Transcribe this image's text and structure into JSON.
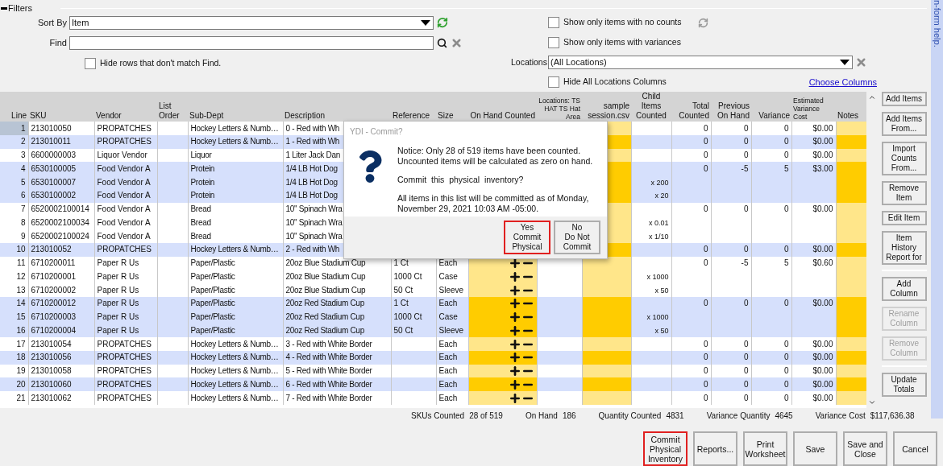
{
  "filters": {
    "title": "Filters",
    "sort_by": {
      "label": "Sort By",
      "value": "Item"
    },
    "find": {
      "label": "Find"
    },
    "hide_rows": {
      "label": "Hide rows that don't match Find.",
      "checked": false
    },
    "no_counts": {
      "label": "Show only items with no counts",
      "checked": false
    },
    "variances": {
      "label": "Show only items with variances",
      "checked": false
    },
    "locations": {
      "label": "Locations",
      "value": "(All Locations)"
    },
    "hide_locations": {
      "label": "Hide All Locations Columns",
      "checked": false
    },
    "choose_columns": "Choose Columns"
  },
  "table": {
    "columns": [
      "Line",
      "SKU",
      "Vendor",
      "List Order",
      "Sub-Dept",
      "Description",
      "Reference",
      "Size",
      "On Hand Counted",
      "Locations: TS HAT TS Hat Area",
      "sample session.csv",
      "Child Items Counted",
      "Total Counted",
      "Previous On Hand",
      "Variance",
      "Estimated Variance Cost",
      "Notes"
    ],
    "rows": [
      {
        "line": "1",
        "sku": "213010050",
        "vendor": "PROPATCHES",
        "sub_dept": "Hockey Letters & Numb…",
        "description": "0 - Red with Wh",
        "total": "0",
        "previous": "0",
        "variance": "0",
        "cost": "$0.00",
        "shaded": false,
        "selected": true
      },
      {
        "line": "2",
        "sku": "213010011",
        "vendor": "PROPATCHES",
        "sub_dept": "Hockey Letters & Numb…",
        "description": "1 - Red with Wh",
        "total": "0",
        "previous": "0",
        "variance": "0",
        "cost": "$0.00",
        "shaded": true,
        "selected": false
      },
      {
        "line": "3",
        "sku": "6600000003",
        "vendor": "Liquor Vendor",
        "sub_dept": "Liquor",
        "description": "1 Liter Jack Dan",
        "total": "0",
        "previous": "0",
        "variance": "0",
        "cost": "$0.00",
        "shaded": false,
        "selected": false
      },
      {
        "line": "4",
        "sku": "6530100005",
        "vendor": "Food Vendor A",
        "sub_dept": "Protein",
        "description": "1/4 LB Hot Dog",
        "total": "0",
        "previous": "-5",
        "variance": "5",
        "cost": "$3.00",
        "shaded": true,
        "selected": false
      },
      {
        "line": "5",
        "sku": "6530100007",
        "vendor": "Food Vendor A",
        "sub_dept": "Protein",
        "description": "1/4 LB Hot Dog",
        "child": "x 200",
        "shaded": true,
        "selected": false
      },
      {
        "line": "6",
        "sku": "6530100002",
        "vendor": "Food Vendor A",
        "sub_dept": "Protein",
        "description": "1/4 LB Hot Dog",
        "child": "x 20",
        "shaded": true,
        "selected": false
      },
      {
        "line": "7",
        "sku": "6520002100014",
        "vendor": "Food Vendor A",
        "sub_dept": "Bread",
        "description": "10\" Spinach Wra",
        "total": "0",
        "previous": "0",
        "variance": "0",
        "cost": "$0.00",
        "shaded": false,
        "selected": false
      },
      {
        "line": "8",
        "sku": "6520002100034",
        "vendor": "Food Vendor A",
        "sub_dept": "Bread",
        "description": "10\" Spinach Wra",
        "child": "x 0.01",
        "shaded": false,
        "selected": false
      },
      {
        "line": "9",
        "sku": "6520002100024",
        "vendor": "Food Vendor A",
        "sub_dept": "Bread",
        "description": "10\" Spinach Wra",
        "child": "x 1/10",
        "shaded": false,
        "selected": false
      },
      {
        "line": "10",
        "sku": "213010052",
        "vendor": "PROPATCHES",
        "sub_dept": "Hockey Letters & Numb…",
        "description": "2 - Red with Wh",
        "total": "0",
        "previous": "0",
        "variance": "0",
        "cost": "$0.00",
        "shaded": true,
        "selected": false
      },
      {
        "line": "11",
        "sku": "6710200011",
        "vendor": "Paper R Us",
        "sub_dept": "Paper/Plastic",
        "description": "20oz Blue Stadium Cup",
        "reference": "1 Ct",
        "size": "Each",
        "total": "0",
        "previous": "-5",
        "variance": "5",
        "cost": "$0.60",
        "shaded": false,
        "selected": false
      },
      {
        "line": "12",
        "sku": "6710200001",
        "vendor": "Paper R Us",
        "sub_dept": "Paper/Plastic",
        "description": "20oz Blue Stadium Cup",
        "reference": "1000 Ct",
        "size": "Case",
        "child": "x 1000",
        "shaded": false,
        "selected": false
      },
      {
        "line": "13",
        "sku": "6710200002",
        "vendor": "Paper R Us",
        "sub_dept": "Paper/Plastic",
        "description": "20oz Blue Stadium Cup",
        "reference": "50 Ct",
        "size": "Sleeve",
        "child": "x 50",
        "shaded": false,
        "selected": false
      },
      {
        "line": "14",
        "sku": "6710200012",
        "vendor": "Paper R Us",
        "sub_dept": "Paper/Plastic",
        "description": "20oz Red Stadium Cup",
        "reference": "1 Ct",
        "size": "Each",
        "total": "0",
        "previous": "0",
        "variance": "0",
        "cost": "$0.00",
        "shaded": true,
        "selected": false
      },
      {
        "line": "15",
        "sku": "6710200003",
        "vendor": "Paper R Us",
        "sub_dept": "Paper/Plastic",
        "description": "20oz Red Stadium Cup",
        "reference": "1000 Ct",
        "size": "Case",
        "child": "x 1000",
        "shaded": true,
        "selected": false
      },
      {
        "line": "16",
        "sku": "6710200004",
        "vendor": "Paper R Us",
        "sub_dept": "Paper/Plastic",
        "description": "20oz Red Stadium Cup",
        "reference": "50 Ct",
        "size": "Sleeve",
        "child": "x 50",
        "shaded": true,
        "selected": false
      },
      {
        "line": "17",
        "sku": "213010054",
        "vendor": "PROPATCHES",
        "sub_dept": "Hockey Letters & Numb…",
        "description": "3 - Red with White Border",
        "size": "Each",
        "total": "0",
        "previous": "0",
        "variance": "0",
        "cost": "$0.00",
        "shaded": false,
        "selected": false
      },
      {
        "line": "18",
        "sku": "213010056",
        "vendor": "PROPATCHES",
        "sub_dept": "Hockey Letters & Numb…",
        "description": "4 - Red with White Border",
        "size": "Each",
        "total": "0",
        "previous": "0",
        "variance": "0",
        "cost": "$0.00",
        "shaded": true,
        "selected": false
      },
      {
        "line": "19",
        "sku": "213010058",
        "vendor": "PROPATCHES",
        "sub_dept": "Hockey Letters & Numb…",
        "description": "5 - Red with White Border",
        "size": "Each",
        "total": "0",
        "previous": "0",
        "variance": "0",
        "cost": "$0.00",
        "shaded": false,
        "selected": false
      },
      {
        "line": "20",
        "sku": "213010060",
        "vendor": "PROPATCHES",
        "sub_dept": "Hockey Letters & Numb…",
        "description": "6 - Red with White Border",
        "size": "Each",
        "total": "0",
        "previous": "0",
        "variance": "0",
        "cost": "$0.00",
        "shaded": true,
        "selected": false
      },
      {
        "line": "21",
        "sku": "213010062",
        "vendor": "PROPATCHES",
        "sub_dept": "Hockey Letters & Numb…",
        "description": "7 - Red with White Border",
        "size": "Each",
        "total": "0",
        "previous": "0",
        "variance": "0",
        "cost": "$0.00",
        "shaded": false,
        "selected": false
      }
    ]
  },
  "side_button_groups": [
    [
      {
        "label": "Add Items",
        "disabled": false
      },
      {
        "label": "Add Items\nFrom...",
        "disabled": false
      },
      {
        "label": "Import\nCounts\nFrom...",
        "disabled": false
      },
      {
        "label": "Remove\nItem",
        "disabled": false
      },
      {
        "label": "Edit Item",
        "disabled": false
      },
      {
        "label": "Item\nHistory\nReport for",
        "disabled": false
      }
    ],
    [
      {
        "label": "Add\nColumn",
        "disabled": false
      },
      {
        "label": "Rename\nColumn",
        "disabled": true
      },
      {
        "label": "Remove\nColumn",
        "disabled": true
      }
    ],
    [
      {
        "label": "Update\nTotals",
        "disabled": false
      }
    ]
  ],
  "totals": [
    {
      "label": "SKUs Counted",
      "value": "28 of 519"
    },
    {
      "label": "On Hand",
      "value": "186"
    },
    {
      "label": "Quantity Counted",
      "value": "4831"
    },
    {
      "label": "Variance Quantity",
      "value": "4645"
    },
    {
      "label": "Variance Cost",
      "value": "$117,636.38"
    }
  ],
  "bottom_buttons": [
    {
      "label": "Commit\nPhysical\nInventory",
      "highlighted": true
    },
    {
      "label": "Reports...",
      "highlighted": false
    },
    {
      "label": "Print\nWorksheet",
      "highlighted": false
    },
    {
      "label": "Save",
      "highlighted": false
    },
    {
      "label": "Save and\nClose",
      "highlighted": false
    },
    {
      "label": "Cancel",
      "highlighted": false
    }
  ],
  "help_strip": "n-form help.",
  "dialog": {
    "title": "YDI - Commit?",
    "paragraphs": [
      "Notice: Only 28 of 519 items have been counted.  Uncounted items will be calculated as zero on hand.",
      "Commit  this  physical  inventory?",
      "All items in this list will be committed as of Monday, November 29, 2021 10:03 AM -05:00."
    ],
    "buttons": [
      {
        "label": "Yes\nCommit\nPhysical",
        "highlighted": true
      },
      {
        "label": "No\nDo Not\nCommit",
        "highlighted": false
      }
    ]
  }
}
